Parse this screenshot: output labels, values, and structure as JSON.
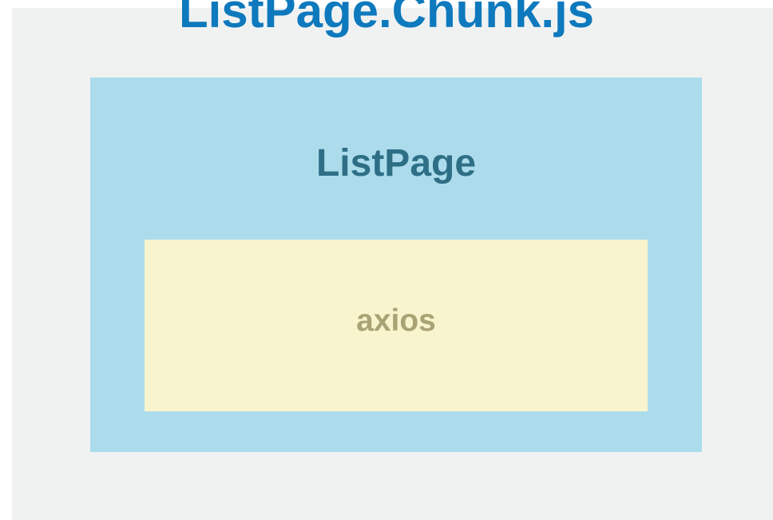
{
  "chunk": {
    "title": "ListPage.Chunk.js",
    "component": {
      "label": "ListPage",
      "dependency": {
        "label": "axios"
      }
    }
  },
  "colors": {
    "chunk_background": "#f0f2f2",
    "chunk_title": "#0e79bd",
    "component_background": "#acdcec",
    "component_label": "#2e6f86",
    "dependency_background": "#f8f4cd",
    "dependency_label": "#aaa375"
  }
}
